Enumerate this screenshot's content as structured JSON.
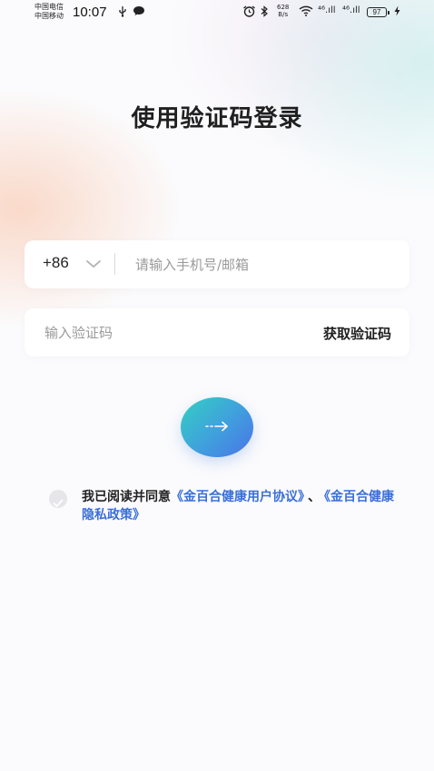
{
  "status_bar": {
    "carrier_1": "中国电信",
    "carrier_2": "中国移动",
    "time": "10:07",
    "net_speed_value": "628",
    "net_speed_unit": "B/s",
    "signal_1": "⁴⁶.ıll",
    "signal_2": "⁴⁶.ıll",
    "battery": "97"
  },
  "login": {
    "title": "使用验证码登录",
    "country_code": "+86",
    "phone_placeholder": "请输入手机号/邮箱",
    "code_placeholder": "输入验证码",
    "get_code_label": "获取验证码"
  },
  "agreement": {
    "prefix": "我已阅读并同意",
    "user_agreement": "《金百合健康用户协议》",
    "separator": "、",
    "privacy_policy": "《金百合健康隐私政策》"
  },
  "colors": {
    "accent_link": "#3a6fd8",
    "button_gradient_start": "#33d0c2",
    "button_gradient_end": "#4a73e8"
  },
  "icons": {
    "submit": "arrow-right-icon",
    "dropdown": "chevron-down-icon",
    "checkbox": "check-icon"
  }
}
